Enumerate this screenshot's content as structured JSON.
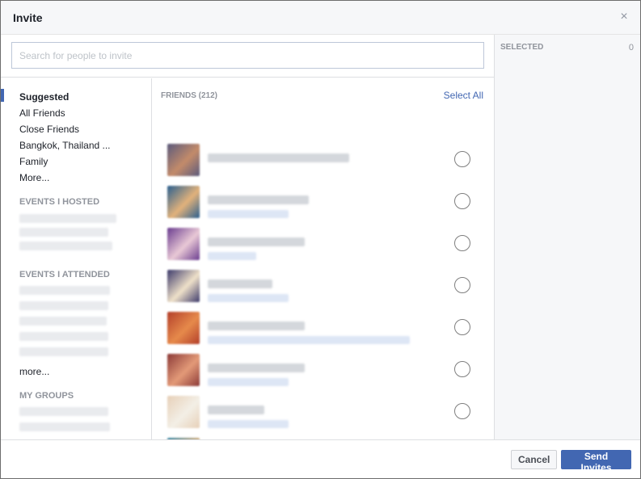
{
  "dialog": {
    "title": "Invite",
    "close_glyph": "×",
    "close_icon": "close-icon"
  },
  "search": {
    "placeholder": "Search for people to invite",
    "value": ""
  },
  "nav": {
    "items": [
      {
        "label": "Suggested",
        "active": true
      },
      {
        "label": "All Friends"
      },
      {
        "label": "Close Friends"
      },
      {
        "label": "Bangkok, Thailand ..."
      },
      {
        "label": "Family"
      },
      {
        "label": "More..."
      }
    ],
    "events_hosted_heading": "EVENTS I HOSTED",
    "events_attended_heading": "EVENTS I ATTENDED",
    "events_attended_more": "more...",
    "my_groups_heading": "MY GROUPS"
  },
  "friends": {
    "heading": "FRIENDS (212)",
    "select_all": "Select All",
    "rows": [
      {
        "avatar_colors": [
          "#5b5a7c",
          "#c38b6a"
        ]
      },
      {
        "avatar_colors": [
          "#2a5f8f",
          "#e2b27b"
        ]
      },
      {
        "avatar_colors": [
          "#6a3c8f",
          "#e9c9d6"
        ]
      },
      {
        "avatar_colors": [
          "#3d3a6b",
          "#efe1c9"
        ]
      },
      {
        "avatar_colors": [
          "#b33f2a",
          "#e68a4b"
        ]
      },
      {
        "avatar_colors": [
          "#8c3a38",
          "#e39a78"
        ]
      },
      {
        "avatar_colors": [
          "#e7d0b8",
          "#f3efe6"
        ]
      },
      {
        "avatar_colors": [
          "#3d88a5",
          "#d8b07f"
        ]
      }
    ]
  },
  "selected": {
    "label": "SELECTED",
    "count": "0"
  },
  "footer": {
    "cancel_label": "Cancel",
    "send_label": "Send Invites"
  },
  "colors": {
    "accent": "#4267b2",
    "header_bg": "#f6f7f9",
    "muted_text": "#90949c"
  }
}
